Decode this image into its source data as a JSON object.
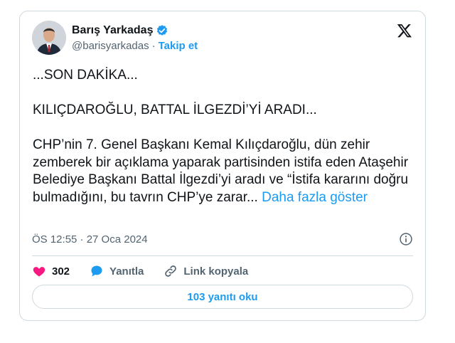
{
  "author": {
    "name": "Barış Yarkadaş",
    "handle": "@barisyarkadas",
    "separator": "·",
    "follow_label": "Takip et"
  },
  "tweet": {
    "line1": "...SON DAKİKA...",
    "line2": "KILIÇDAROĞLU, BATTAL İLGEZDİ’Yİ ARADI...",
    "body": "CHP’nin 7. Genel Başkanı Kemal Kılıçdaroğlu, dün zehir zemberek bir açıklama yaparak partisinden istifa eden Ataşehir Belediye Başkanı Battal İlgezdi’yi aradı ve “İstifa kararını doğru bulmadığını, bu tavrın CHP’ye zarar... ",
    "show_more": "Daha fazla göster",
    "timestamp": "ÖS 12:55 · 27 Oca 2024"
  },
  "actions": {
    "likes": "302",
    "reply_label": "Yanıtla",
    "copy_link_label": "Link kopyala"
  },
  "replies_button": "103 yanıtı oku",
  "colors": {
    "accent": "#1d9bf0",
    "like": "#f91880",
    "border": "#cfd9de",
    "muted": "#536471"
  }
}
